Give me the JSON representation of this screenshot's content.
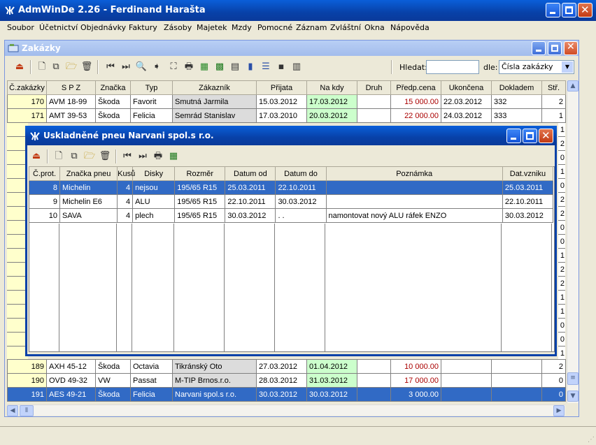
{
  "app": {
    "title": "AdmWinDe 2.26 - Ferdinand Harašta"
  },
  "menu": [
    "Soubor",
    "Účetnictví",
    "Objednávky",
    "Faktury",
    "Zásoby",
    "Majetek",
    "Mzdy",
    "Pomocné",
    "Záznam",
    "Zvláštní",
    "Okna",
    "Nápověda"
  ],
  "zakazky": {
    "title": "Zakázky",
    "search_label": "Hledat:",
    "search_value": "",
    "by_label": "dle:",
    "by_value": "Čísla zakázky",
    "columns": [
      "Č.zakázky",
      "S P Z",
      "Značka",
      "Typ",
      "Zákazník",
      "Přijata",
      "Na kdy",
      "Druh",
      "Předp.cena",
      "Ukončena",
      "Dokladem",
      "Stř."
    ],
    "rows_top": [
      {
        "c": "170",
        "spz": "AVM 18-99",
        "znacka": "Škoda",
        "typ": "Favorit",
        "zakaznik": "Smutná Jarmila",
        "prijata": "15.03.2012",
        "nakdy": "17.03.2012",
        "druh": "",
        "cena": "15 000.00",
        "ukoncena": "22.03.2012",
        "doklad": "332",
        "str": "2"
      },
      {
        "c": "171",
        "spz": "AMT 39-53",
        "znacka": "Škoda",
        "typ": "Felicia",
        "zakaznik": "Semrád Stanislav",
        "prijata": "17.03.2010",
        "nakdy": "20.03.2012",
        "druh": "",
        "cena": "22 000.00",
        "ukoncena": "24.03.2012",
        "doklad": "333",
        "str": "1"
      }
    ],
    "side_str": [
      "1",
      "2",
      "0",
      "1",
      "0",
      "2",
      "2",
      "0",
      "0",
      "1",
      "2",
      "2",
      "1",
      "1",
      "0",
      "0",
      "1"
    ],
    "rows_bottom": [
      {
        "c": "189",
        "spz": "AXH 45-12",
        "znacka": "Škoda",
        "typ": "Octavia",
        "zakaznik": "Tikránský Oto",
        "prijata": "27.03.2012",
        "nakdy": "01.04.2012",
        "druh": "",
        "cena": "10 000.00",
        "ukoncena": "",
        "doklad": "",
        "str": "2"
      },
      {
        "c": "190",
        "spz": "OVD 49-32",
        "znacka": "VW",
        "typ": "Passat",
        "zakaznik": "M-TIP Brnos.r.o.",
        "prijata": "28.03.2012",
        "nakdy": "31.03.2012",
        "druh": "",
        "cena": "17 000.00",
        "ukoncena": "",
        "doklad": "",
        "str": "0"
      },
      {
        "c": "191",
        "spz": "AES 49-21",
        "znacka": "Škoda",
        "typ": "Felicia",
        "zakaznik": "Narvani spol.s r.o.",
        "prijata": "30.03.2012",
        "nakdy": "30.03.2012",
        "druh": "",
        "cena": "3 000.00",
        "ukoncena": "",
        "doklad": "",
        "str": "0"
      }
    ]
  },
  "pneu": {
    "title": "Uskladněné pneu Narvani spol.s r.o.",
    "columns": [
      "Č.prot.",
      "Značka pneu",
      "Kusů",
      "Disky",
      "Rozměr",
      "Datum od",
      "Datum do",
      "Poznámka",
      "Dat.vzniku"
    ],
    "rows": [
      {
        "cprot": "8",
        "znacka": "Michelin",
        "kusu": "4",
        "disky": "nejsou",
        "rozmer": "195/65 R15",
        "od": "25.03.2011",
        "do": "22.10.2011",
        "pozn": "",
        "vznik": "25.03.2011"
      },
      {
        "cprot": "9",
        "znacka": "Michelin E6",
        "kusu": "4",
        "disky": "ALU",
        "rozmer": "195/65 R15",
        "od": "22.10.2011",
        "do": "30.03.2012",
        "pozn": "",
        "vznik": "22.10.2011"
      },
      {
        "cprot": "10",
        "znacka": "SAVA",
        "kusu": "4",
        "disky": "plech",
        "rozmer": "195/65 R15",
        "od": "30.03.2012",
        "do": " .  .",
        "pozn": "namontovat nový ALU ráfek ENZO",
        "vznik": "30.03.2012"
      }
    ]
  }
}
